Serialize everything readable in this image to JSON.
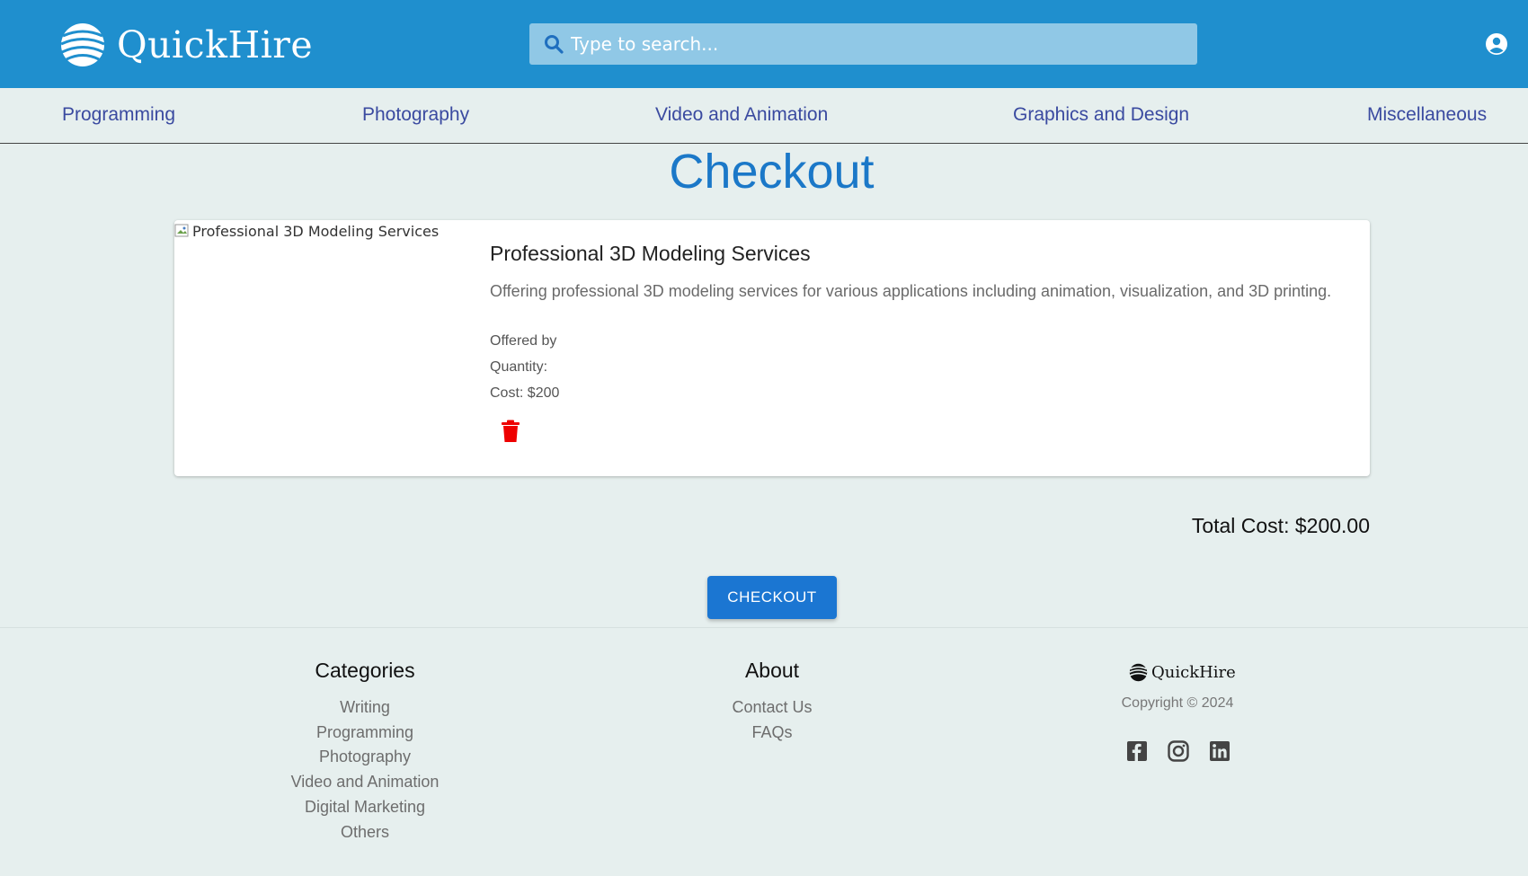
{
  "header": {
    "brand": "QuickHire",
    "search_placeholder": "Type to search...",
    "colors": {
      "bar": "#1f8fce",
      "search_bg": "#90c8e6"
    }
  },
  "nav": {
    "items": [
      "Programming",
      "Photography",
      "Video and Animation",
      "Graphics and Design",
      "Miscellaneous"
    ]
  },
  "page": {
    "title": "Checkout"
  },
  "cart": {
    "item": {
      "image_alt": "Professional 3D Modeling Services",
      "title": "Professional 3D Modeling Services",
      "description": "Offering professional 3D modeling services for various applications including animation, visualization, and 3D printing.",
      "offered_by": "Offered by",
      "quantity": "Quantity:",
      "cost": "Cost: $200",
      "delete_icon": "trash-icon",
      "delete_color": "#ee0000"
    },
    "total": "Total Cost: $200.00",
    "checkout_label": "CHECKOUT"
  },
  "footer": {
    "categories": {
      "heading": "Categories",
      "links": [
        "Writing",
        "Programming",
        "Photography",
        "Video and Animation",
        "Digital Marketing",
        "Others"
      ]
    },
    "about": {
      "heading": "About",
      "links": [
        "Contact Us",
        "FAQs"
      ]
    },
    "brand": "QuickHire",
    "copyright": "Copyright © 2024",
    "social_icons": [
      "facebook-icon",
      "instagram-icon",
      "linkedin-icon"
    ]
  }
}
